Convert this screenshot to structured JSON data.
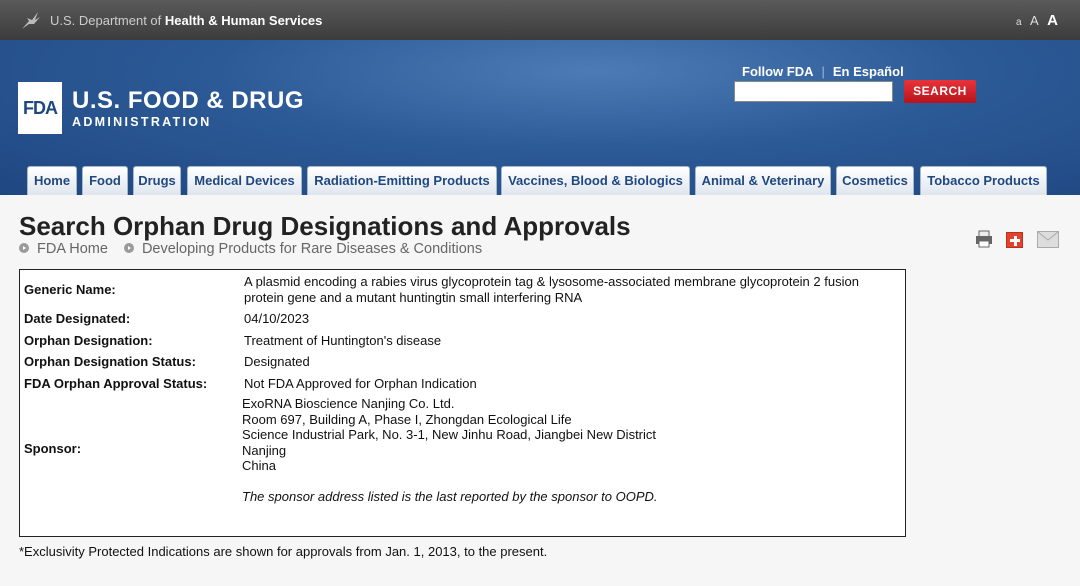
{
  "hhs": {
    "prefix": "U.S. Department of ",
    "bold": "Health & Human Services",
    "font_sizes": [
      "a",
      "A",
      "A"
    ]
  },
  "header": {
    "logo_text": "FDA",
    "title": "U.S. FOOD & DRUG",
    "subtitle": "ADMINISTRATION",
    "follow": "Follow FDA",
    "separator": "|",
    "espanol": "En Español",
    "search_placeholder": "",
    "search_label": "SEARCH"
  },
  "nav": {
    "tabs": [
      "Home",
      "Food",
      "Drugs",
      "Medical Devices",
      "Radiation-Emitting Products",
      "Vaccines, Blood & Biologics",
      "Animal & Veterinary",
      "Cosmetics",
      "Tobacco Products"
    ]
  },
  "page": {
    "title": "Search Orphan Drug Designations and Approvals",
    "breadcrumbs": [
      "FDA Home",
      "Developing Products for Rare Diseases & Conditions"
    ]
  },
  "details": {
    "generic_name_label": "Generic Name:",
    "generic_name_line1": "A plasmid encoding a rabies virus glycoprotein tag & lysosome-associated membrane glycoprotein 2 fusion",
    "generic_name_line2": "protein gene and a mutant huntingtin small interfering RNA",
    "date_label": "Date Designated:",
    "date_value": "04/10/2023",
    "designation_label": "Orphan Designation:",
    "designation_value": "Treatment of Huntington's disease",
    "status_label": "Orphan Designation Status:",
    "status_value": "Designated",
    "approval_label": "FDA Orphan Approval Status:",
    "approval_value": "Not FDA Approved for Orphan Indication",
    "sponsor_label": "Sponsor:",
    "sponsor_lines": [
      "ExoRNA Bioscience Nanjing Co. Ltd.",
      "Room 697, Building A, Phase I, Zhongdan Ecological Life",
      "Science Industrial Park, No. 3-1, New Jinhu Road, Jiangbei New District",
      "Nanjing",
      "China"
    ],
    "sponsor_note": "The sponsor address listed is the last reported by the sponsor to OOPD."
  },
  "footnote": "*Exclusivity Protected Indications are shown for approvals from Jan. 1, 2013, to the present.",
  "colors": {
    "fda_blue": "#1f4781",
    "search_red": "#d0242b"
  }
}
